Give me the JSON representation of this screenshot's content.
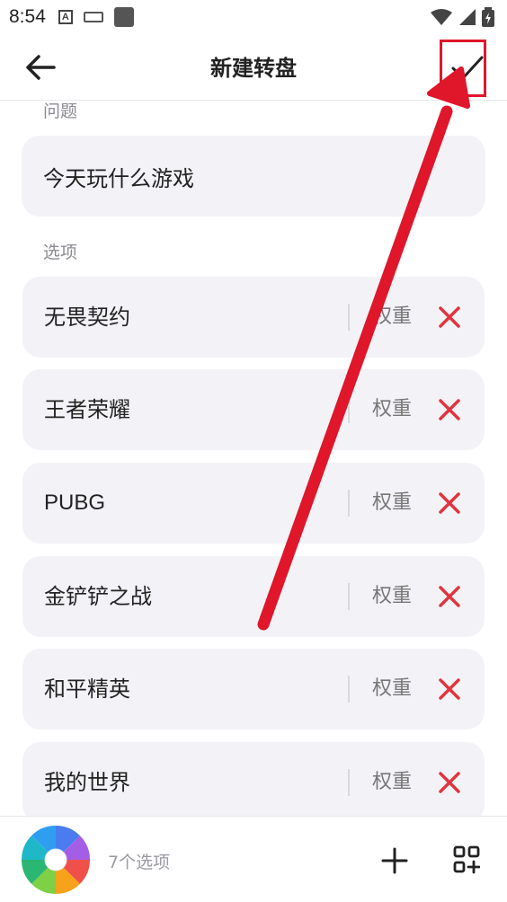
{
  "status_bar": {
    "time": "8:54",
    "icons": [
      "a-icon",
      "keyboard-icon",
      "app-icon",
      "wifi-icon",
      "signal-icon",
      "battery-charging-icon"
    ]
  },
  "header": {
    "title": "新建转盘",
    "back_icon": "arrow-left-icon",
    "confirm_icon": "checkmark-icon"
  },
  "question": {
    "section_label": "问题",
    "value": "今天玩什么游戏"
  },
  "options": {
    "section_label": "选项",
    "weight_label": "权重",
    "remove_icon": "close-x-icon",
    "accent_color": "#e0353f",
    "items": [
      {
        "label": "无畏契约"
      },
      {
        "label": "王者荣耀"
      },
      {
        "label": "PUBG"
      },
      {
        "label": "金铲铲之战"
      },
      {
        "label": "和平精英"
      },
      {
        "label": "我的世界"
      }
    ]
  },
  "bottom_bar": {
    "count_text": "7个选项",
    "add_icon": "plus-icon",
    "grid_icon": "grid-add-icon",
    "wheel_icon": "color-wheel-icon"
  },
  "annotation": {
    "color": "#e0162b"
  }
}
